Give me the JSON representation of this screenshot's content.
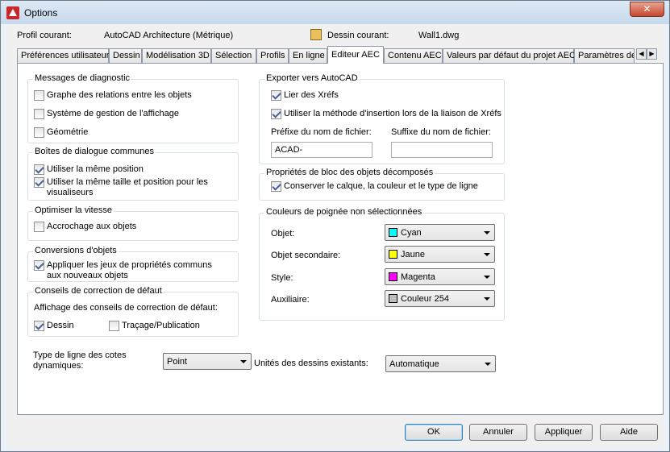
{
  "window": {
    "title": "Options",
    "close_label": "✕"
  },
  "profile": {
    "current_label": "Profil courant:",
    "current_value": "AutoCAD Architecture (Métrique)",
    "drawing_label": "Dessin courant:",
    "drawing_value": "Wall1.dwg"
  },
  "tabs": [
    "Préférences utilisateur",
    "Dessin",
    "Modélisation 3D",
    "Sélection",
    "Profils",
    "En ligne",
    "Editeur AEC",
    "Contenu AEC",
    "Valeurs par défaut du projet AEC",
    "Paramètres de"
  ],
  "diagnostic": {
    "title": "Messages de diagnostic",
    "items": [
      "Graphe des relations entre les objets",
      "Système de gestion de l'affichage",
      "Géométrie"
    ]
  },
  "dialogs": {
    "title": "Boîtes de dialogue communes",
    "items": [
      "Utiliser la même position",
      "Utiliser la même taille et position pour les visualiseurs"
    ]
  },
  "speed": {
    "title": "Optimiser la vitesse",
    "items": [
      "Accrochage aux objets"
    ]
  },
  "conversions": {
    "title": "Conversions d'objets",
    "items": [
      "Appliquer les jeux de propriétés communs aux nouveaux objets"
    ]
  },
  "fault": {
    "title": "Conseils de correction de défaut",
    "subtitle": "Affichage des conseils de correction de défaut:",
    "items": [
      "Dessin",
      "Traçage/Publication"
    ]
  },
  "dimline": {
    "label": "Type de ligne des cotes dynamiques:",
    "value": "Point"
  },
  "export": {
    "title": "Exporter vers AutoCAD",
    "items": [
      "Lier des Xréfs",
      "Utiliser la méthode d'insertion lors de la liaison de Xréfs"
    ],
    "prefix_label": "Préfixe du nom de fichier:",
    "prefix_value": "ACAD-",
    "suffix_label": "Suffixe du nom de fichier:",
    "suffix_value": ""
  },
  "block": {
    "title": "Propriétés de bloc des objets décomposés",
    "items": [
      "Conserver le calque, la couleur et le type de ligne"
    ]
  },
  "grips": {
    "title": "Couleurs de poignée non sélectionnées",
    "rows": [
      {
        "label": "Objet:",
        "value": "Cyan",
        "color": "#00ffff"
      },
      {
        "label": "Objet secondaire:",
        "value": "Jaune",
        "color": "#ffff00"
      },
      {
        "label": "Style:",
        "value": "Magenta",
        "color": "#ff00ff"
      },
      {
        "label": "Auxiliaire:",
        "value": "Couleur 254",
        "color": "#bebebe"
      }
    ]
  },
  "units": {
    "label": "Unités des dessins existants:",
    "value": "Automatique"
  },
  "buttons": {
    "ok": "OK",
    "cancel": "Annuler",
    "apply": "Appliquer",
    "help": "Aide"
  }
}
